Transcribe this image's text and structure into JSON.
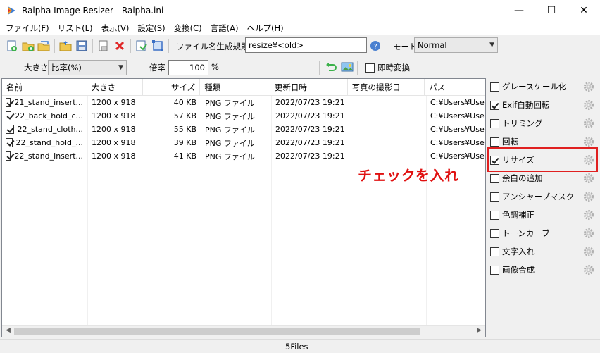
{
  "window": {
    "title": "Ralpha Image Resizer - Ralpha.ini",
    "minimize": "—",
    "maximize": "☐",
    "close": "✕"
  },
  "menu": [
    "ファイル(F)",
    "リスト(L)",
    "表示(V)",
    "設定(S)",
    "変換(C)",
    "言語(A)",
    "ヘルプ(H)"
  ],
  "toolbar1": {
    "filename_rule_label": "ファイル名生成規則",
    "filename_rule_value": "resize¥<old>",
    "mode_label": "モード",
    "mode_value": "Normal"
  },
  "toolbar2": {
    "size_label": "大きさ",
    "size_value": "比率(%)",
    "ratio_label": "倍率",
    "ratio_value": "100",
    "percent_unit": "%",
    "instant_convert_label": "即時変換"
  },
  "filelist": {
    "columns": [
      "名前",
      "大きさ",
      "サイズ",
      "種類",
      "更新日時",
      "写真の撮影日",
      "パス"
    ],
    "rows": [
      {
        "name": "21_stand_insert...",
        "dims": "1200 x 918",
        "size": "40 KB",
        "type": "PNG ファイル",
        "modified": "2022/07/23 19:21",
        "shot": "",
        "path": "C:¥Users¥User¥"
      },
      {
        "name": "22_back_hold_c...",
        "dims": "1200 x 918",
        "size": "57 KB",
        "type": "PNG ファイル",
        "modified": "2022/07/23 19:21",
        "shot": "",
        "path": "C:¥Users¥User¥"
      },
      {
        "name": "22_stand_cloth...",
        "dims": "1200 x 918",
        "size": "55 KB",
        "type": "PNG ファイル",
        "modified": "2022/07/23 19:21",
        "shot": "",
        "path": "C:¥Users¥User¥"
      },
      {
        "name": "22_stand_hold_...",
        "dims": "1200 x 918",
        "size": "39 KB",
        "type": "PNG ファイル",
        "modified": "2022/07/23 19:21",
        "shot": "",
        "path": "C:¥Users¥User¥"
      },
      {
        "name": "22_stand_insert...",
        "dims": "1200 x 918",
        "size": "41 KB",
        "type": "PNG ファイル",
        "modified": "2022/07/23 19:21",
        "shot": "",
        "path": "C:¥Users¥User¥"
      }
    ]
  },
  "panel": {
    "items": [
      {
        "label": "グレースケール化",
        "checked": false
      },
      {
        "label": "Exif自動回転",
        "checked": true
      },
      {
        "label": "トリミング",
        "checked": false
      },
      {
        "label": "回転",
        "checked": false
      },
      {
        "label": "リサイズ",
        "checked": true
      },
      {
        "label": "余白の追加",
        "checked": false
      },
      {
        "label": "アンシャープマスク",
        "checked": false
      },
      {
        "label": "色調補正",
        "checked": false
      },
      {
        "label": "トーンカーブ",
        "checked": false
      },
      {
        "label": "文字入れ",
        "checked": false
      },
      {
        "label": "画像合成",
        "checked": false
      }
    ]
  },
  "annotation": "チェックを入れ",
  "status": {
    "file_count": "5Files"
  },
  "colors": {
    "highlight": "#e02020",
    "annotation": "#e01010"
  }
}
